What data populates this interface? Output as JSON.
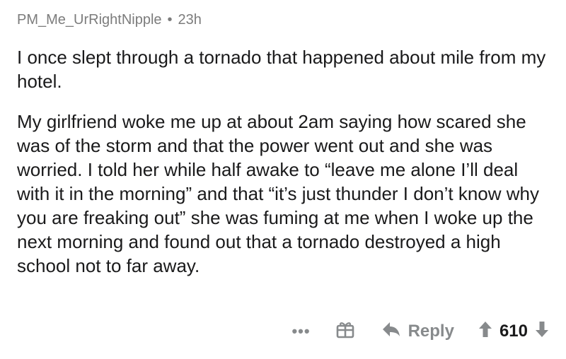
{
  "comment": {
    "username": "PM_Me_UrRightNipple",
    "separator": "•",
    "time_ago": "23h",
    "paragraphs": [
      "I once slept through a tornado that happened about mile from my hotel.",
      "My girlfriend woke me up at about 2am saying how scared she was of the storm and that the power went out and she was worried. I told her while half awake to “leave me alone I’ll deal with it in the morning” and that “it’s just thunder I don’t know why you are freaking out” she was fuming at me when I woke up the next morning and found out that a tornado destroyed a high school not to far away."
    ]
  },
  "actions": {
    "more_label": "•••",
    "award_icon": "gift-box-icon",
    "reply_icon": "reply-arrow-icon",
    "reply_label": "Reply",
    "upvote_icon": "arrow-up-icon",
    "score": "610",
    "downvote_icon": "arrow-down-icon"
  },
  "colors": {
    "text": "#1a1a1b",
    "muted": "#7c7c7c",
    "icon": "#878a8c"
  }
}
